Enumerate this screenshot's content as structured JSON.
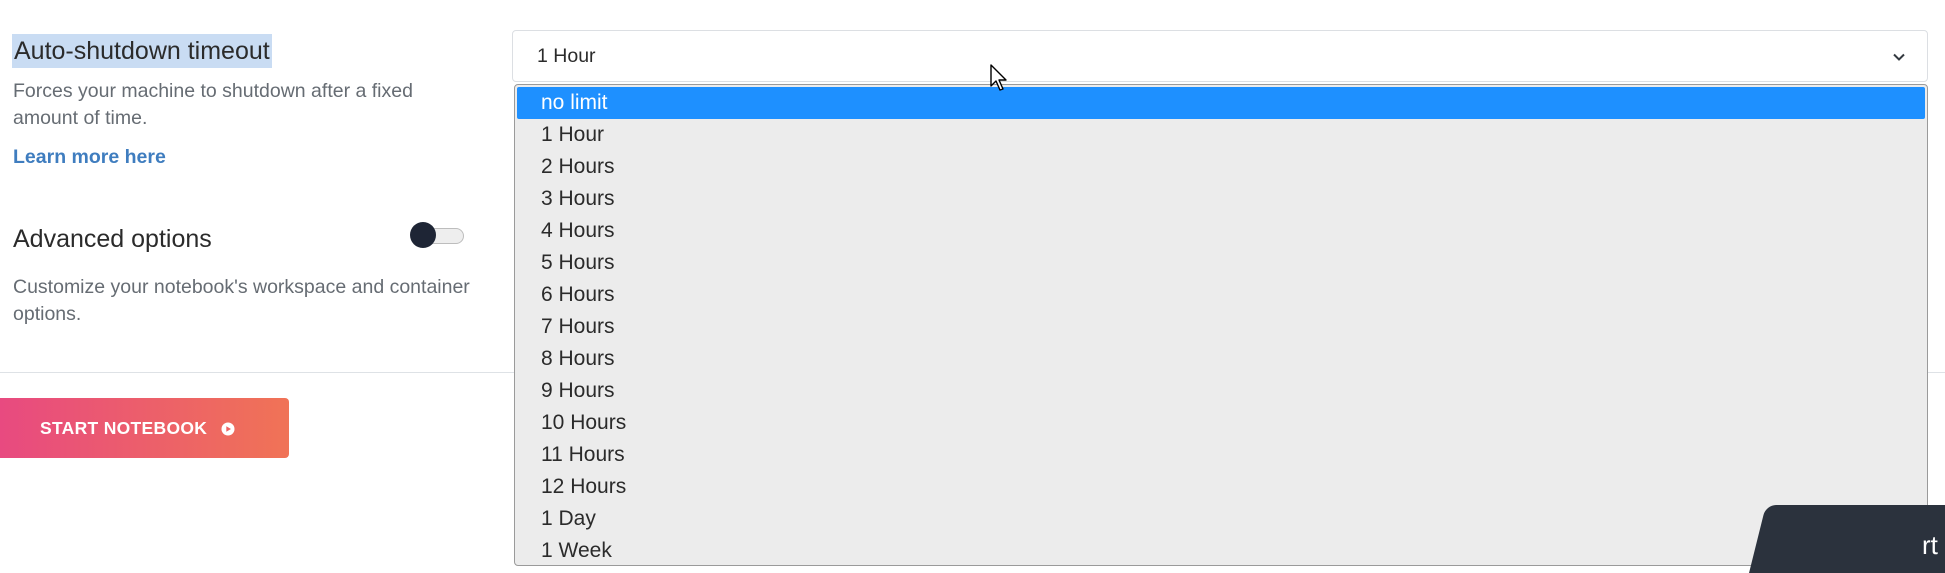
{
  "autoshutdown": {
    "title": "Auto-shutdown timeout",
    "description": "Forces your machine to shutdown after a fixed amount of time.",
    "learn_more": "Learn more here"
  },
  "advanced": {
    "title": "Advanced options",
    "description": "Customize your notebook's workspace and container options.",
    "toggle_on": false
  },
  "select": {
    "value": "1 Hour",
    "options": [
      "no limit",
      "1 Hour",
      "2 Hours",
      "3 Hours",
      "4 Hours",
      "5 Hours",
      "6 Hours",
      "7 Hours",
      "8 Hours",
      "9 Hours",
      "10 Hours",
      "11 Hours",
      "12 Hours",
      "1 Day",
      "1 Week"
    ],
    "highlighted_option": "no limit"
  },
  "start_button": {
    "label": "START NOTEBOOK"
  },
  "corner_chip": {
    "text": "rt"
  },
  "colors": {
    "highlight": "#1e90ff",
    "link": "#3f7dbf",
    "button_gradient_start": "#e84a80",
    "button_gradient_end": "#f07356"
  },
  "icons": {
    "chevron": "chevron-down-icon",
    "play": "play-circle-icon",
    "cursor": "mouse-cursor-icon"
  }
}
